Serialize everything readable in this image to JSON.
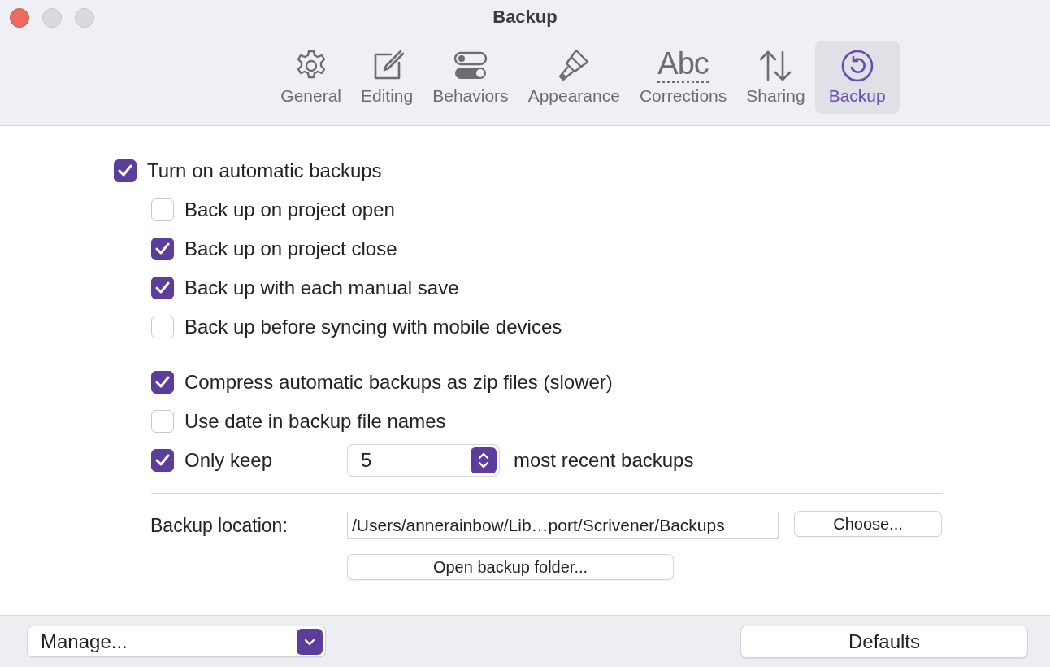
{
  "window": {
    "title": "Backup"
  },
  "toolbar": [
    {
      "label": "General",
      "selected": false
    },
    {
      "label": "Editing",
      "selected": false
    },
    {
      "label": "Behaviors",
      "selected": false
    },
    {
      "label": "Appearance",
      "selected": false
    },
    {
      "label": "Corrections",
      "selected": false,
      "glyph": "Abc"
    },
    {
      "label": "Sharing",
      "selected": false
    },
    {
      "label": "Backup",
      "selected": true
    }
  ],
  "main_option": {
    "label": "Turn on automatic backups",
    "checked": true
  },
  "backup_triggers": [
    {
      "label": "Back up on project open",
      "checked": false
    },
    {
      "label": "Back up on project close",
      "checked": true
    },
    {
      "label": "Back up with each manual save",
      "checked": true
    },
    {
      "label": "Back up before syncing with mobile devices",
      "checked": false
    }
  ],
  "storage_options": [
    {
      "kind": "checkbox",
      "label": "Compress automatic backups as zip files (slower)",
      "checked": true
    },
    {
      "kind": "checkbox",
      "label": "Use date in backup file names",
      "checked": false
    },
    {
      "kind": "count",
      "label": "Only keep",
      "checked": true,
      "value": "5",
      "suffix": "most recent backups"
    }
  ],
  "location": {
    "label": "Backup location:",
    "value": "/Users/annerainbow/Lib…port/Scrivener/Backups",
    "choose_button": "Choose...",
    "open_button": "Open backup folder..."
  },
  "footer": {
    "manage": "Manage...",
    "defaults": "Defaults"
  }
}
